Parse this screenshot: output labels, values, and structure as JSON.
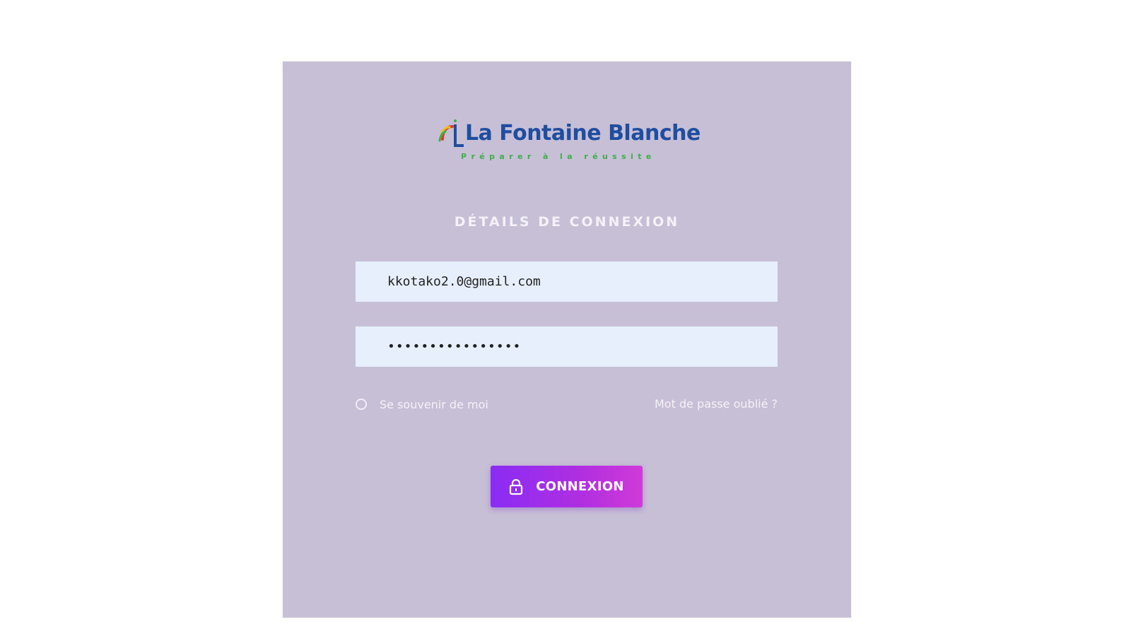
{
  "brand": {
    "name": "La Fontaine Blanche",
    "tagline": "Préparer à la réussite",
    "name_color": "#1f4ea0",
    "tagline_color": "#3cb04a"
  },
  "login": {
    "title": "DÉTAILS DE CONNEXION",
    "email_value": "kkotako2.0@gmail.com",
    "password_value": "••••••••••••••••",
    "remember_label": "Se souvenir de moi",
    "forgot_label": "Mot de passe oublié ?",
    "submit_label": "CONNEXION",
    "submit_icon": "lock-icon"
  },
  "colors": {
    "card_background": "#c7bfd5",
    "input_background": "#e8effc",
    "button_gradient_start": "#8a2cf5",
    "button_gradient_end": "#d03ad9"
  }
}
